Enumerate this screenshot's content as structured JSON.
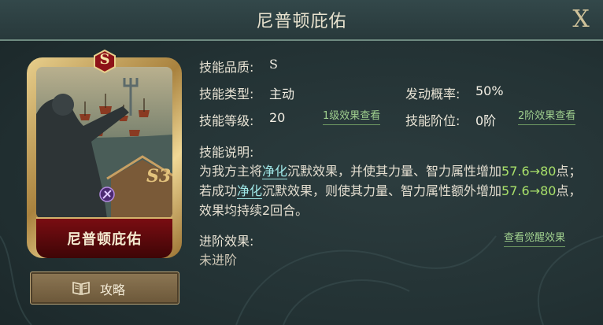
{
  "title": "尼普顿庇佑",
  "close_label": "X",
  "card": {
    "badge": "S",
    "name": "尼普顿庇佑",
    "star_mark": "S3"
  },
  "guide_button": {
    "label": "攻略",
    "icon": "book-icon"
  },
  "fields": {
    "quality_label": "技能品质:",
    "quality_value": "S",
    "type_label": "技能类型:",
    "type_value": "主动",
    "chance_label": "发动概率:",
    "chance_value": "50%",
    "level_label": "技能等级:",
    "level_value": "20",
    "level_link": "1级效果查看",
    "tier_label": "技能阶位:",
    "tier_value": "0阶",
    "tier_link": "2阶效果查看"
  },
  "description": {
    "label": "技能说明:",
    "p1": "为我方主将",
    "k1": "净化",
    "p2": "沉默效果，并使其力量、智力属性增加",
    "n1": "57.6",
    "n2": "→80",
    "p3": "点；若成功",
    "k2": "净化",
    "p4": "沉默效果，则使其力量、智力属性额外增加",
    "n3": "57.6",
    "n4": "→80",
    "p5": "点，效果均持续2回合。"
  },
  "advance": {
    "label": "进阶效果:",
    "value": "未进阶",
    "link": "查看觉醒效果"
  },
  "colors": {
    "accent_green": "#a8e06a",
    "keyword_cyan": "#9fe6e6",
    "link_green": "#9fcf8e",
    "card_red": "#7a0d12",
    "gold": "#d4b36c"
  }
}
